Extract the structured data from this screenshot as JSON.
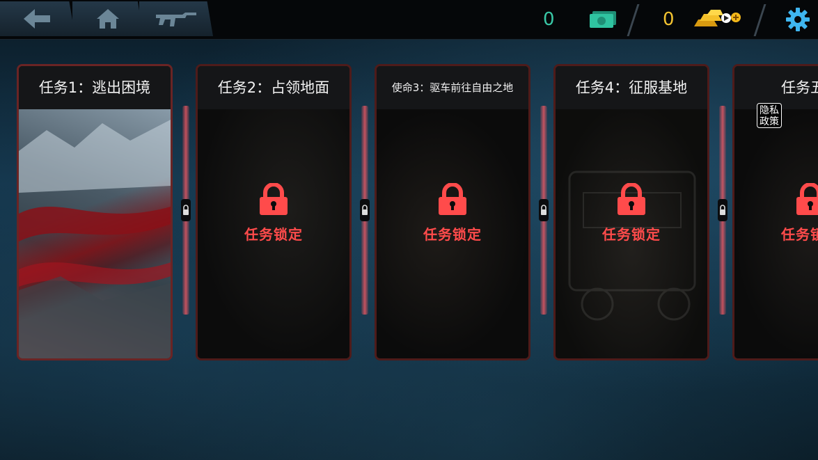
{
  "topbar": {
    "nav": [
      {
        "name": "back-button",
        "icon": "back-arrow-icon"
      },
      {
        "name": "home-button",
        "icon": "home-icon"
      },
      {
        "name": "weapon-button",
        "icon": "rifle-icon"
      }
    ],
    "cash_amount": "0",
    "gold_amount": "0",
    "cash_icon": "cash-icon",
    "gold_icon": "gold-bars-icon",
    "settings_icon": "gear-icon"
  },
  "missions": [
    {
      "title": "任务1：逃出困境",
      "locked": false
    },
    {
      "title": "任务2：占领地面",
      "locked": true,
      "lock_text": "任务锁定"
    },
    {
      "title": "使命3：驱车前往自由之地",
      "locked": true,
      "lock_text": "任务锁定"
    },
    {
      "title": "任务4：征服基地",
      "locked": true,
      "lock_text": "任务锁定"
    },
    {
      "title": "任务五：",
      "locked": true,
      "lock_text": "任务锁定"
    }
  ],
  "privacy_badge": {
    "line1": "隐私",
    "line2": "政策"
  },
  "colors": {
    "accent_red": "#ff4b4b",
    "cash_text": "#39c7a6",
    "gold_text": "#f2c230",
    "settings_blue": "#3fb6f0"
  }
}
